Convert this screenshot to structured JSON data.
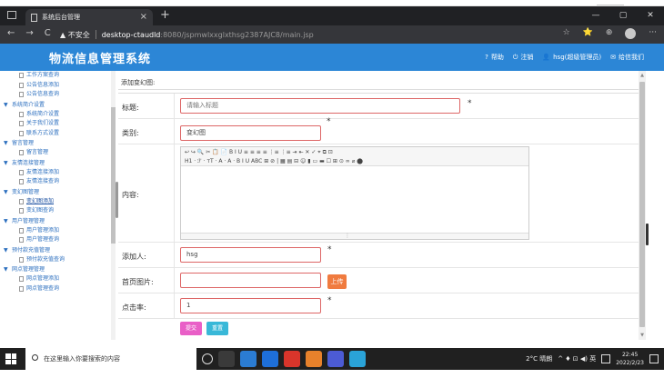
{
  "browser": {
    "tab_title": "系统后台管理",
    "tab_close": "×",
    "new_tab": "+",
    "window_controls": [
      "—",
      "▢",
      "✕"
    ],
    "nav_icons": [
      "←",
      "→",
      "C"
    ],
    "security_label": "▲ 不安全",
    "url_host": "desktop-ctaudld",
    "url_path": ":8080/jspmwlxxglxthsg2387AJC8/main.jsp",
    "right_icons": [
      "☆",
      "⭐",
      "⊕",
      "···"
    ]
  },
  "header": {
    "title": "物流信息管理系统",
    "links": [
      {
        "icon": "?",
        "label": "帮助"
      },
      {
        "icon": "⏻",
        "label": "注销"
      },
      {
        "icon": "👤",
        "label": "hsg(超级管理员)"
      },
      {
        "icon": "✉",
        "label": "给信我们"
      }
    ]
  },
  "sidebar": {
    "items": [
      {
        "type": "item",
        "label": "工作方案查询"
      },
      {
        "type": "item",
        "label": "公告信息添加"
      },
      {
        "type": "item",
        "label": "公告信息查询"
      },
      {
        "type": "group",
        "label": "系统简介设置"
      },
      {
        "type": "item",
        "label": "系统简介设置"
      },
      {
        "type": "item",
        "label": "关于我们设置"
      },
      {
        "type": "item",
        "label": "联系方式设置"
      },
      {
        "type": "group",
        "label": "留言管理"
      },
      {
        "type": "item",
        "label": "留言管理"
      },
      {
        "type": "group",
        "label": "友情连接管理"
      },
      {
        "type": "item",
        "label": "友情连接添加"
      },
      {
        "type": "item",
        "label": "友情连接查询"
      },
      {
        "type": "group",
        "label": "变幻图管理"
      },
      {
        "type": "item",
        "label": "变幻图添加",
        "active": true
      },
      {
        "type": "item",
        "label": "变幻图查询"
      },
      {
        "type": "group",
        "label": "用户管理管理"
      },
      {
        "type": "item",
        "label": "用户管理添加"
      },
      {
        "type": "item",
        "label": "用户管理查询"
      },
      {
        "type": "group",
        "label": "预付款充值管理"
      },
      {
        "type": "item",
        "label": "预付款充值查询"
      },
      {
        "type": "group",
        "label": "网点管理管理"
      },
      {
        "type": "item",
        "label": "网点管理添加"
      },
      {
        "type": "item",
        "label": "网点管理查询"
      }
    ]
  },
  "form": {
    "heading": "添加变幻图:",
    "title_label": "标题:",
    "title_placeholder": "请输入标题",
    "category_label": "类别:",
    "category_value": "变幻图",
    "content_label": "内容:",
    "author_label": "添加人:",
    "author_value": "hsg",
    "image_label": "首页图片:",
    "image_value": "",
    "upload_label": "上传",
    "clicks_label": "点击率:",
    "clicks_value": "1",
    "required_mark": "*",
    "submit_label": "提交",
    "reset_label": "重置"
  },
  "editor": {
    "toolbar_row1": "↩ ↪ 🔍 ✂ 📋 📄 B I U ≡ ≡ ≡ ≡ ⋮≡ ⋮≡ ⇥ ⇤ ✕ ✓ ⌖ ⧉ ⊡",
    "toolbar_row2": "H1 · ℱ · тT · A · A · B I U ABC ⊞ ⊘ | ▦ ▤ ⊟ ☺ ▮ ▭ ▬ ☐ ⊞ ⊙ ∞ ⌀ ⬤"
  },
  "taskbar": {
    "search_placeholder": "在这里输入你要搜索的内容",
    "weather": "2°C 晴朗",
    "tray": "^ ♦ ⊡ ◀) 英",
    "time": "22:45",
    "date": "2022/2/23"
  }
}
